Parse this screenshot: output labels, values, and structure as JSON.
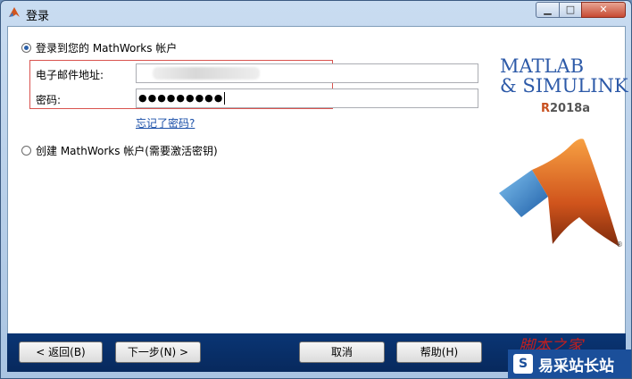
{
  "window": {
    "title": "登录"
  },
  "login_option": {
    "label": "登录到您的 MathWorks 帐户",
    "selected": true
  },
  "email": {
    "label": "电子邮件地址:",
    "value": ""
  },
  "password": {
    "label": "密码:",
    "value": "●●●●●●●●●"
  },
  "forgot_link": "忘记了密码?",
  "create_option": {
    "label": "创建 MathWorks 帐户(需要激活密钥)",
    "selected": false
  },
  "brand": {
    "line1": "MATLAB",
    "line2": "& SIMULINK",
    "version_r": "R",
    "version": "2018a"
  },
  "buttons": {
    "back": "< 返回(B)",
    "next": "下一步(N) >",
    "cancel": "取消",
    "help": "帮助(H)"
  },
  "watermark": {
    "top": "脚本之家",
    "icon": "S",
    "bottom": "易采站长站"
  },
  "colors": {
    "accent": "#2a5fa8",
    "titlebar": "#b9d1ea",
    "bottombar": "#0a3574",
    "highlight": "#d9534f"
  }
}
